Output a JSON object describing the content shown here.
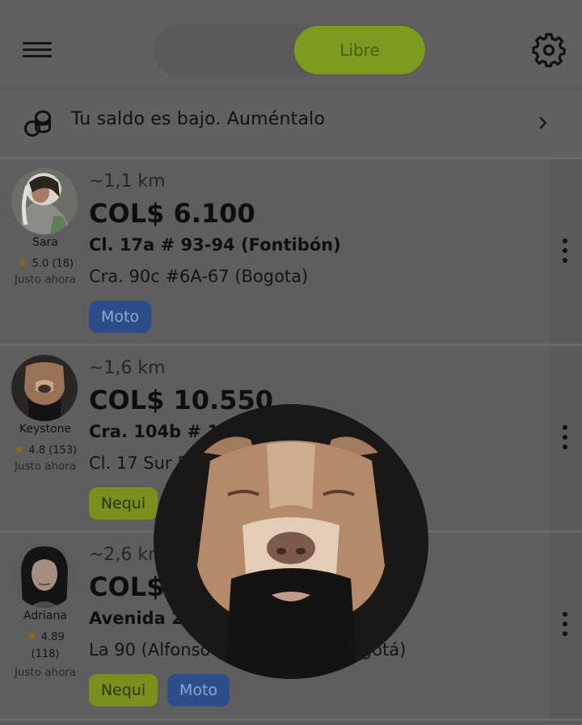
{
  "header": {
    "mode_free_label": "Libre"
  },
  "balance_banner": {
    "text": "Tu saldo es bajo. Auméntalo"
  },
  "requests": [
    {
      "name": "Sara",
      "rating": "5.0",
      "rating_count": "(18)",
      "time": "Justo ahora",
      "distance": "~1,1 km",
      "price": "COL$ 6.100",
      "pickup": "Cl. 17a # 93-94 (Fontibón)",
      "dropoff": "Cra. 90c #6A-67 (Bogota)",
      "tags": [
        "Moto"
      ]
    },
    {
      "name": "Keystone",
      "rating": "4.8",
      "rating_count": "(153)",
      "time": "Justo ahora",
      "distance": "~1,6 km",
      "price": "COL$ 10.550",
      "pickup": "Cra. 104b # 1",
      "dropoff": "Cl. 17 Sur 5",
      "tags": [
        "Nequi"
      ]
    },
    {
      "name": "Adriana",
      "rating": "4.89",
      "rating_count": "(118)",
      "time": "Justo ahora",
      "distance": "~2,6 km",
      "price": "COL$",
      "pickup": "Avenida 2",
      "dropoff": "La 90 (Alfonso",
      "dropoff_tail": "ogotá)",
      "tags": [
        "Nequi",
        "Moto"
      ]
    }
  ],
  "icons": {
    "menu": "hamburger-menu-icon",
    "settings": "gear-icon",
    "balance": "coins-icon",
    "chevron": "chevron-right-icon",
    "more": "more-vertical-icon",
    "star": "star-icon"
  },
  "colors": {
    "accent_green": "#7e9a1f",
    "moto_tag": "#2c4f8c",
    "nequi_tag": "#7a8f1c"
  }
}
